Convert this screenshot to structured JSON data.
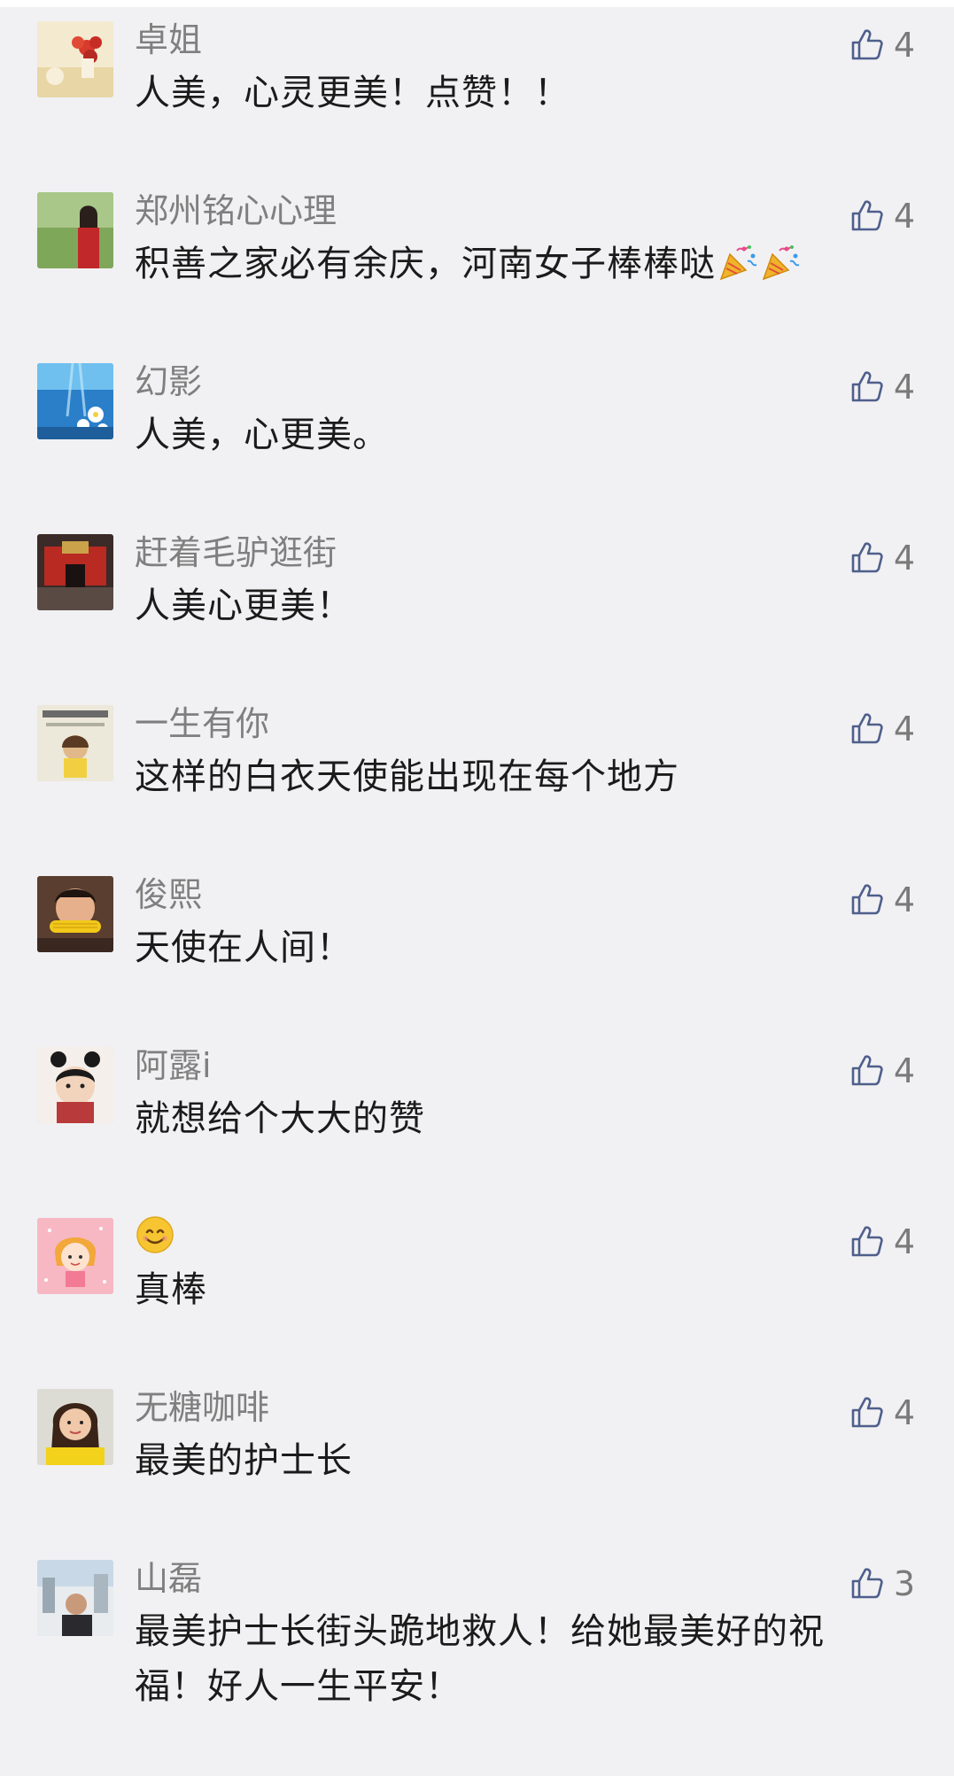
{
  "comments": [
    {
      "user": "卓姐",
      "text": "人美，心灵更美！点赞！！",
      "likes": "4",
      "avatar": "flowers"
    },
    {
      "user": "郑州铭心心理",
      "text": "积善之家必有余庆，河南女子棒棒哒",
      "likes": "4",
      "avatar": "woman-garden",
      "trailing_emoji": [
        "party-popper-icon",
        "party-popper-icon"
      ]
    },
    {
      "user": "幻影",
      "text": "人美，心更美。",
      "likes": "4",
      "avatar": "underwater-flowers"
    },
    {
      "user": "赶着毛驴逛街",
      "text": "人美心更美！",
      "likes": "4",
      "avatar": "red-building"
    },
    {
      "user": "一生有你",
      "text": "这样的白衣天使能出现在每个地方",
      "likes": "4",
      "avatar": "screenshot-child"
    },
    {
      "user": "俊熙",
      "text": "天使在人间！",
      "likes": "4",
      "avatar": "child-corn"
    },
    {
      "user": "阿露i",
      "text": "就想给个大大的赞",
      "likes": "4",
      "avatar": "girl-buns"
    },
    {
      "user": "",
      "text": "真棒",
      "likes": "4",
      "avatar": "cartoon-girl",
      "nick_emoji": "smiling-face-icon"
    },
    {
      "user": "无糖咖啡",
      "text": "最美的护士长",
      "likes": "4",
      "avatar": "woman-yellow"
    },
    {
      "user": "山磊",
      "text": "最美护士长街头跪地救人！给她最美好的祝福！好人一生平安！",
      "likes": "3",
      "avatar": "man-street"
    }
  ],
  "colors": {
    "background": "#f1f1f3",
    "nickname": "#7f7f7f",
    "text": "#1b1b1b",
    "like_icon": "#4f5f8c"
  }
}
